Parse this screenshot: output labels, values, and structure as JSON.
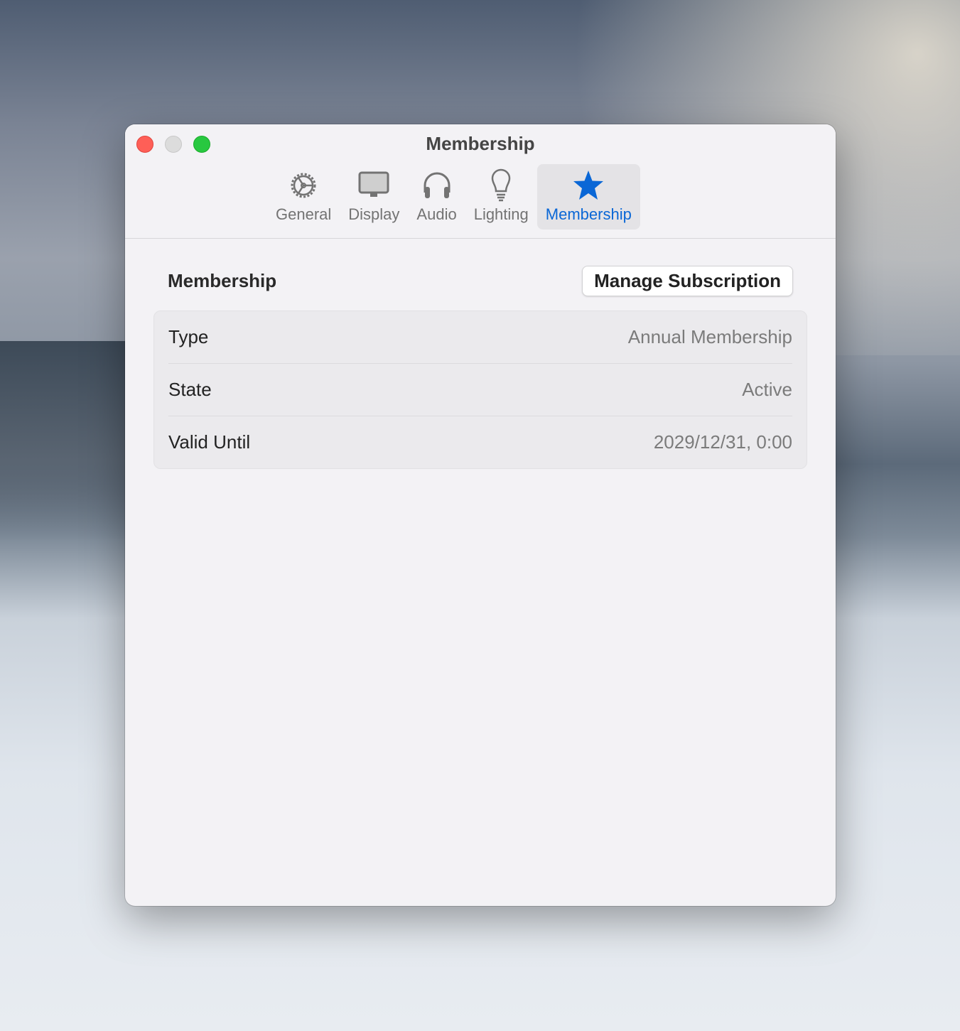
{
  "window": {
    "title": "Membership"
  },
  "tabs": [
    {
      "label": "General",
      "icon": "gear-icon"
    },
    {
      "label": "Display",
      "icon": "display-icon"
    },
    {
      "label": "Audio",
      "icon": "headphones-icon"
    },
    {
      "label": "Lighting",
      "icon": "lightbulb-icon"
    },
    {
      "label": "Membership",
      "icon": "star-icon",
      "active": true
    }
  ],
  "section": {
    "title": "Membership",
    "button": "Manage Subscription"
  },
  "rows": [
    {
      "label": "Type",
      "value": "Annual Membership"
    },
    {
      "label": "State",
      "value": "Active"
    },
    {
      "label": "Valid Until",
      "value": "2029/12/31, 0:00"
    }
  ],
  "colors": {
    "accent": "#0a67d6"
  }
}
